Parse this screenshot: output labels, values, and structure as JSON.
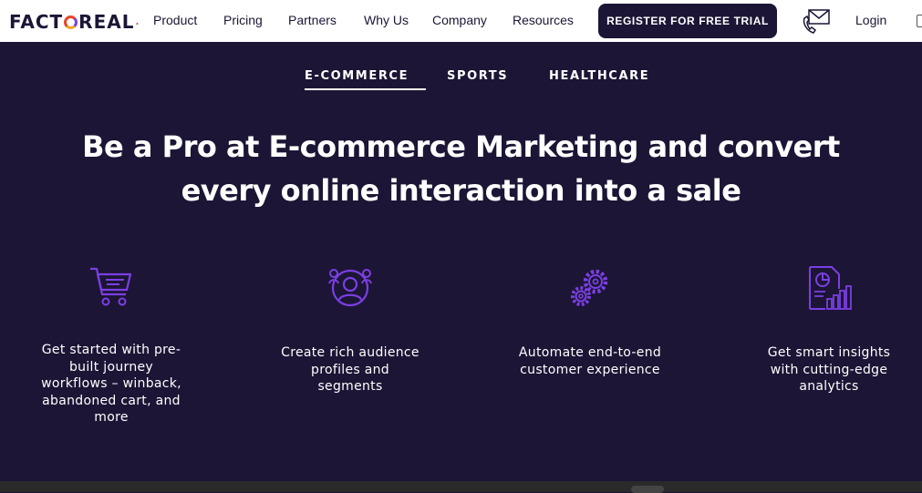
{
  "header": {
    "logo_text_left": "FACT",
    "logo_text_right": "REAL",
    "logo_dot": ".",
    "nav": [
      "Product",
      "Pricing",
      "Partners",
      "Why Us",
      "Company",
      "Resources"
    ],
    "cta_label": "REGISTER FOR FREE TRIAL",
    "login_label": "Login"
  },
  "tabs": [
    {
      "label": "E-COMMERCE",
      "active": true
    },
    {
      "label": "SPORTS",
      "active": false
    },
    {
      "label": "HEALTHCARE",
      "active": false
    }
  ],
  "hero": {
    "title_line1": "Be a Pro at E-commerce Marketing and convert",
    "title_line2": "every online interaction into a sale"
  },
  "features": [
    {
      "icon": "shopping-cart-icon",
      "lines": [
        "Get started with pre-",
        "built journey",
        "workflows – winback,",
        "abandoned cart, and",
        "more"
      ]
    },
    {
      "icon": "audience-profile-icon",
      "lines": [
        "Create rich audience",
        "profiles and",
        "segments"
      ]
    },
    {
      "icon": "gears-icon",
      "lines": [
        "Automate end-to-end",
        "customer experience"
      ]
    },
    {
      "icon": "analytics-report-icon",
      "lines": [
        "Get smart insights",
        "with cutting-edge",
        "analytics"
      ]
    }
  ],
  "colors": {
    "background": "#1c1535",
    "accent": "#7b3fe4",
    "logo_orange": "#e8452c"
  }
}
